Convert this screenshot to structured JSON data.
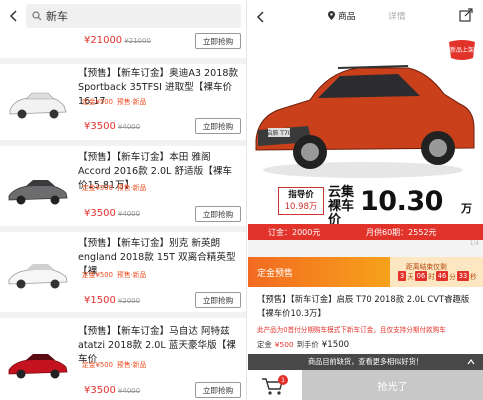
{
  "search": {
    "query": "新车"
  },
  "results": [
    {
      "title": "",
      "tags": [],
      "price": "¥21000",
      "old_price": "¥21000",
      "buy_label": "立即抢购"
    },
    {
      "title": "【预售】【新车订金】奥迪A3 2018款 Sportback 35TFSI 进取型【裸车价16.17",
      "tags": [
        "定金¥500",
        "预售·新品"
      ],
      "price": "¥3500",
      "old_price": "¥4000",
      "buy_label": "立即抢购"
    },
    {
      "title": "【预售】【新车订金】本田 雅阁Accord 2016款 2.0L 舒适版【裸车价15.81万】",
      "tags": [
        "定金¥500",
        "预售·新品"
      ],
      "price": "¥3500",
      "old_price": "¥4000",
      "buy_label": "立即抢购"
    },
    {
      "title": "【预售】【新车订金】别克 新英朗 england 2018款 15T 双离合精英型【裸",
      "tags": [
        "定金¥500",
        "预售·新品"
      ],
      "price": "¥1500",
      "old_price": "¥2000",
      "buy_label": "立即抢购"
    },
    {
      "title": "【预售】【新车订金】马自达 阿特兹 atatzi 2018款 2.0L 蓝天豪华版【裸车价",
      "tags": [
        "定金¥500",
        "预售·新品"
      ],
      "price": "¥3500",
      "old_price": "¥4000",
      "buy_label": "立即抢购"
    }
  ],
  "detail": {
    "tabs": {
      "goods": "商品",
      "details": "详情"
    },
    "badge": "新品上架",
    "plate": "启辰 T70",
    "guide_price_label": "指导价",
    "guide_price": "10.98万",
    "yunji_label": "云集裸车价",
    "main_price": "10.30",
    "main_unit": "万",
    "deposit_text": "订金：2000元",
    "monthly_text": "月供60期：2552元",
    "page_indicator": "1/4",
    "presale_label": "定金预售",
    "countdown_label": "距离结束仅剩",
    "countdown": [
      "3",
      "06",
      "46",
      "33"
    ],
    "countdown_units": [
      "天",
      "时",
      "分",
      "秒"
    ],
    "product_title": "【预售】【新车订金】启辰 T70 2018款 2.0L CVT睿趣版【裸车价10.3万】",
    "product_note": "此产品为0首付分期购车模式下新车订金，且仅支持分期付款购车",
    "deposit_label": "定金",
    "deposit_value": "¥500",
    "arrival_label": "到手价",
    "arrival_value": "¥1500",
    "toast": "商品目前缺货，查看更多相似好货！",
    "cart_count": "1",
    "soldout_label": "抢光了"
  },
  "colors": {
    "accent_red": "#e2322c",
    "presale_orange": "#f26a21"
  }
}
